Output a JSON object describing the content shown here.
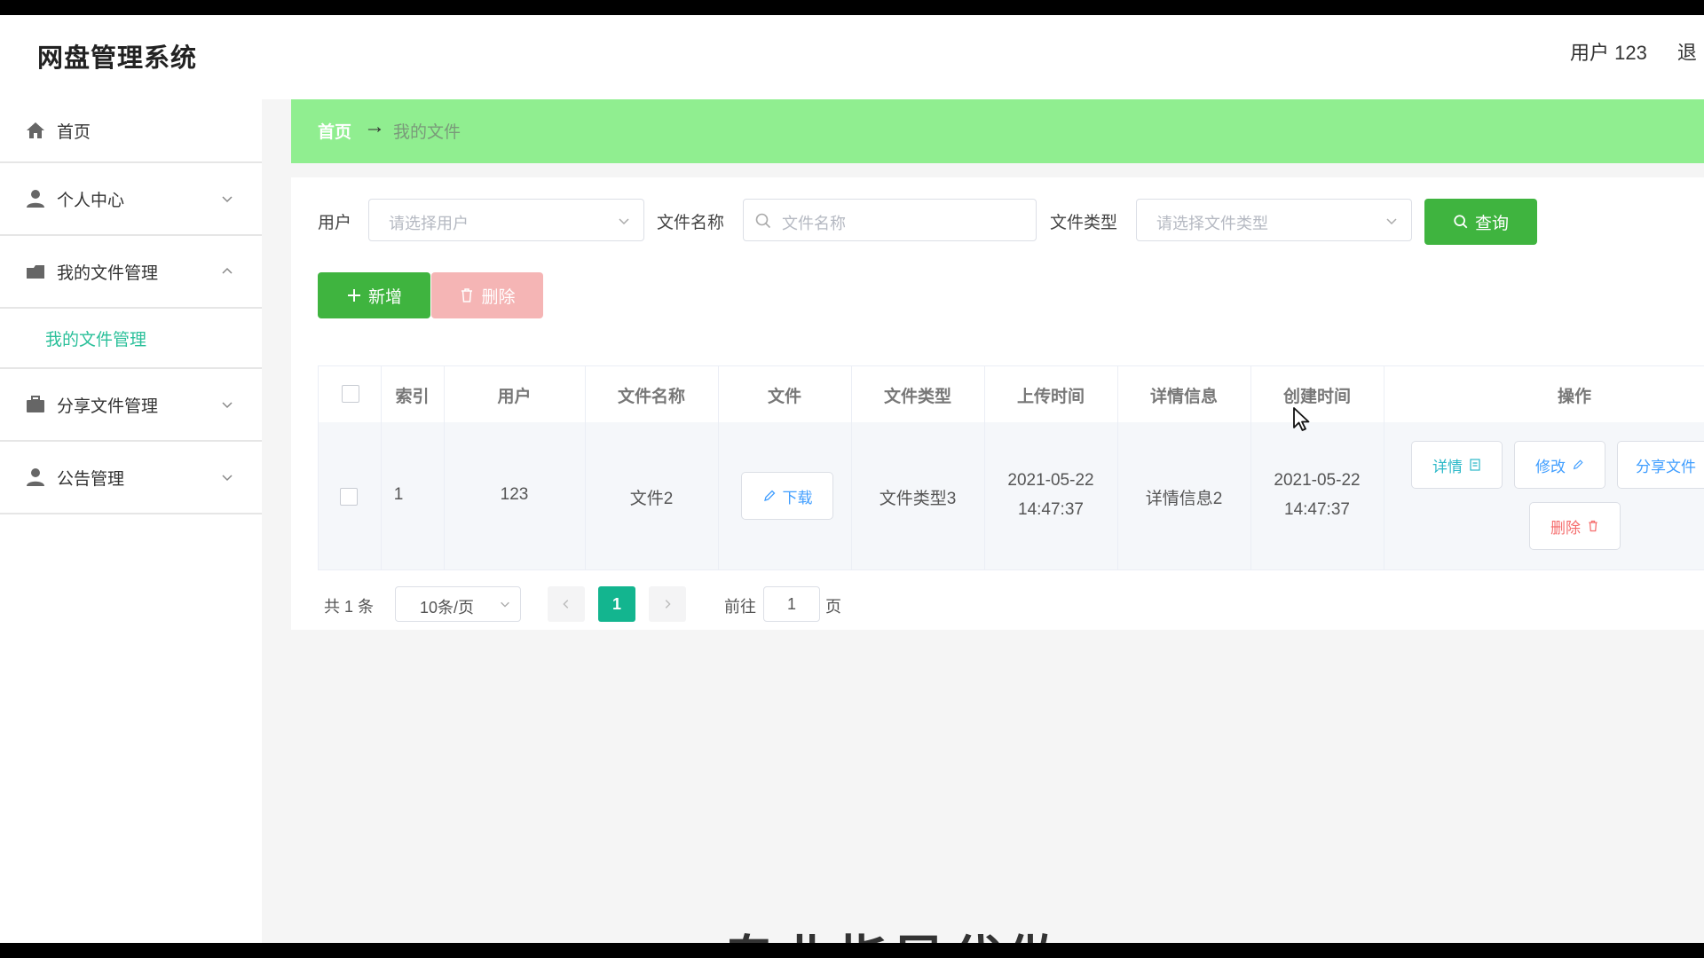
{
  "header": {
    "title": "网盘管理系统",
    "user": "用户 123",
    "logout": "退"
  },
  "sidebar": {
    "items": [
      {
        "label": "首页",
        "icon": "home-icon"
      },
      {
        "label": "个人中心",
        "icon": "user-icon",
        "expanded": false
      },
      {
        "label": "我的文件管理",
        "icon": "folder-icon",
        "expanded": true,
        "children": [
          {
            "label": "我的文件管理",
            "active": true
          }
        ]
      },
      {
        "label": "分享文件管理",
        "icon": "briefcase-icon",
        "expanded": false
      },
      {
        "label": "公告管理",
        "icon": "user-icon",
        "expanded": false
      }
    ]
  },
  "breadcrumb": {
    "home": "首页",
    "separator": "→",
    "current": "我的文件"
  },
  "search": {
    "user_label": "用户",
    "user_placeholder": "请选择用户",
    "name_label": "文件名称",
    "name_placeholder": "文件名称",
    "type_label": "文件类型",
    "type_placeholder": "请选择文件类型",
    "query_button": "查询"
  },
  "actions": {
    "add": "新增",
    "delete": "删除"
  },
  "table": {
    "headers": [
      "索引",
      "用户",
      "文件名称",
      "文件",
      "文件类型",
      "上传时间",
      "详情信息",
      "创建时间",
      "操作"
    ],
    "rows": [
      {
        "index": "1",
        "user": "123",
        "file_name": "文件2",
        "file_button": "下载",
        "file_type": "文件类型3",
        "upload_date": "2021-05-22",
        "upload_time": "14:47:37",
        "details": "详情信息2",
        "created_date": "2021-05-22",
        "created_time": "14:47:37",
        "ops": {
          "detail": "详情",
          "edit": "修改",
          "share": "分享文件",
          "delete": "删除"
        }
      }
    ]
  },
  "pagination": {
    "total": "共 1 条",
    "page_size": "10条/页",
    "current_page": "1",
    "goto_prefix": "前往",
    "goto_value": "1",
    "goto_suffix": "页"
  },
  "caption": "专业指导代做",
  "colors": {
    "accent": "#3fb43f",
    "breadcrumb_bg": "#90ee90",
    "active_menu": "#2bc09a",
    "pager_active": "#13b58f",
    "danger": "#f56c6c",
    "link": "#409eff"
  }
}
